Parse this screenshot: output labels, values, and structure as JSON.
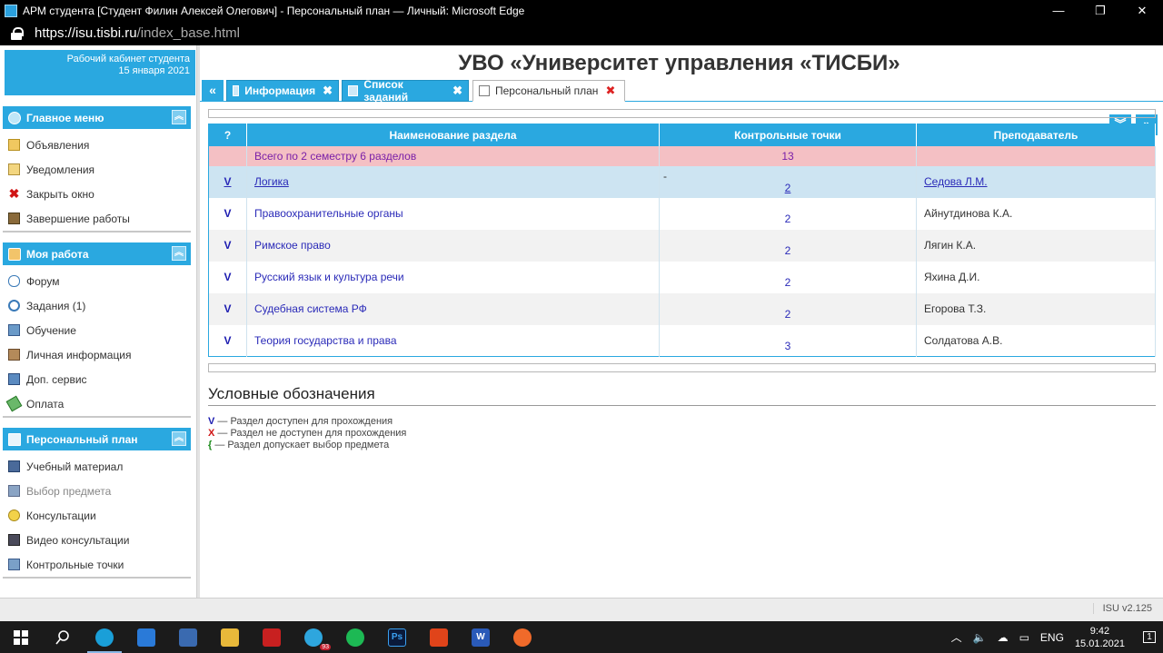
{
  "window": {
    "title": "АРМ студента [Студент Филин Алексей Олегович] - Персональный план — Личный: Microsoft Edge",
    "minimize": "—",
    "maximize": "❐",
    "close": "✕"
  },
  "address": {
    "proto": "https://",
    "host": "isu.tisbi.ru",
    "path": "/index_base.html"
  },
  "cabinet": {
    "title": "Рабочий кабинет студента",
    "date": "15 января 2021"
  },
  "university_title": "УВО «Университет управления «ТИСБИ»",
  "menus": {
    "main": {
      "title": "Главное меню",
      "items": [
        {
          "label": "Объявления",
          "icon": "envelope-icon"
        },
        {
          "label": "Уведомления",
          "icon": "notification-icon"
        },
        {
          "label": "Закрыть окно",
          "icon": "close-x-icon"
        },
        {
          "label": "Завершение работы",
          "icon": "exit-icon"
        }
      ]
    },
    "work": {
      "title": "Моя работа",
      "items": [
        {
          "label": "Форум",
          "icon": "chat-icon"
        },
        {
          "label": "Задания (1)",
          "icon": "clock-icon"
        },
        {
          "label": "Обучение",
          "icon": "book-icon"
        },
        {
          "label": "Личная информация",
          "icon": "person-card-icon"
        },
        {
          "label": "Доп. сервис",
          "icon": "service-icon"
        },
        {
          "label": "Оплата",
          "icon": "money-icon"
        }
      ]
    },
    "plan": {
      "title": "Персональный план",
      "items": [
        {
          "label": "Учебный материал",
          "icon": "notebook-icon"
        },
        {
          "label": "Выбор предмета",
          "icon": "selection-icon",
          "disabled": true
        },
        {
          "label": "Консультации",
          "icon": "bulb-icon"
        },
        {
          "label": "Видео консультации",
          "icon": "camera-icon"
        },
        {
          "label": "Контрольные точки",
          "icon": "checkpoint-icon"
        }
      ]
    }
  },
  "tabs": {
    "nav_left": "«",
    "items": [
      {
        "label": "Информация",
        "icon": "home-icon",
        "active": false
      },
      {
        "label": "Список заданий",
        "icon": "list-icon",
        "active": false
      },
      {
        "label": "Персональный план",
        "icon": "document-icon",
        "active": true
      }
    ],
    "close": "✖",
    "nav_down": "»",
    "nav_right": "»"
  },
  "table": {
    "headers": [
      "?",
      "Наименование раздела",
      "Контрольные точки",
      "Преподаватель"
    ],
    "summary": {
      "label": "Всего по 2 семестру 6 разделов",
      "total": "13"
    },
    "rows": [
      {
        "mark": "V",
        "name": "Логика",
        "cp": "2",
        "teacher": "Седова Л.М.",
        "note": "-"
      },
      {
        "mark": "V",
        "name": "Правоохранительные органы",
        "cp": "2",
        "teacher": "Айнутдинова К.А."
      },
      {
        "mark": "V",
        "name": "Римское право",
        "cp": "2",
        "teacher": "Лягин К.А."
      },
      {
        "mark": "V",
        "name": "Русский язык и культура речи",
        "cp": "2",
        "teacher": "Яхина Д.И."
      },
      {
        "mark": "V",
        "name": "Судебная система РФ",
        "cp": "2",
        "teacher": "Егорова Т.З."
      },
      {
        "mark": "V",
        "name": "Теория государства и права",
        "cp": "3",
        "teacher": "Солдатова А.В."
      }
    ]
  },
  "legend": {
    "title": "Условные обозначения",
    "items": [
      {
        "sym": "V",
        "text": " — Раздел доступен для прохождения",
        "color": "#1c1cb0"
      },
      {
        "sym": "X",
        "text": " — Раздел не доступен для прохождения",
        "color": "#d01515"
      },
      {
        "sym": "{",
        "text": " — Раздел допускает выбор предмета",
        "color": "#1a8a1a"
      }
    ]
  },
  "version": "ISU v2.125",
  "taskbar": {
    "telegram_badge": "93",
    "lang": "ENG",
    "time": "9:42",
    "date": "15.01.2021",
    "notif_count": "1"
  },
  "colors": {
    "accent": "#2aa8e0",
    "summary_row": "#f4c0c4",
    "highlight_row": "#cde4f2"
  }
}
